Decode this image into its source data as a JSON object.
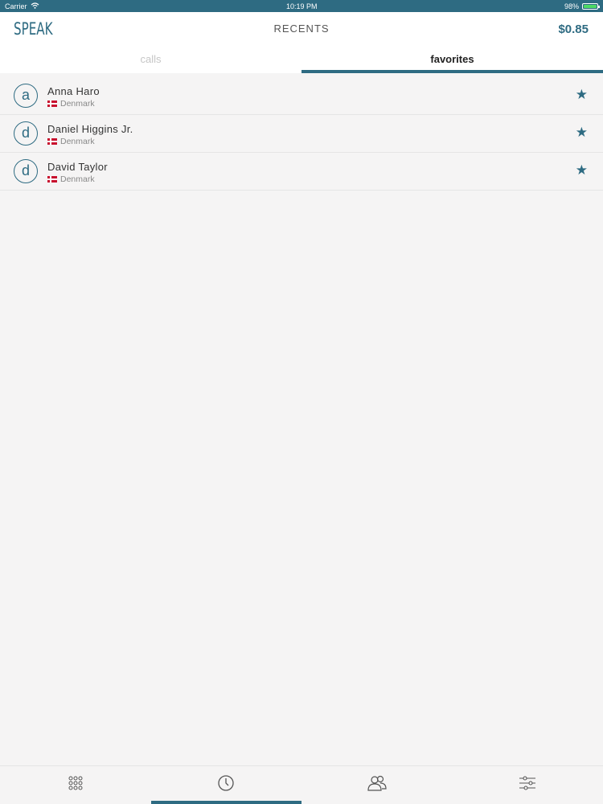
{
  "status_bar": {
    "carrier": "Carrier",
    "time": "10:19 PM",
    "battery": "98%",
    "battery_level": 0.98
  },
  "header": {
    "logo": "SPEAK",
    "title": "RECENTS",
    "balance": "$0.85"
  },
  "tabs": [
    {
      "label": "calls",
      "active": false
    },
    {
      "label": "favorites",
      "active": true
    }
  ],
  "favorites": [
    {
      "initial": "a",
      "name": "Anna Haro",
      "country": "Denmark"
    },
    {
      "initial": "d",
      "name": "Daniel Higgins Jr.",
      "country": "Denmark"
    },
    {
      "initial": "d",
      "name": "David Taylor",
      "country": "Denmark"
    }
  ],
  "bottom_nav": [
    {
      "icon": "keypad-icon",
      "active": false
    },
    {
      "icon": "clock-icon",
      "active": true
    },
    {
      "icon": "contacts-icon",
      "active": false
    },
    {
      "icon": "settings-sliders-icon",
      "active": false
    }
  ],
  "colors": {
    "accent": "#2e6b82",
    "background": "#f5f4f4",
    "flag_red": "#c8102e"
  }
}
